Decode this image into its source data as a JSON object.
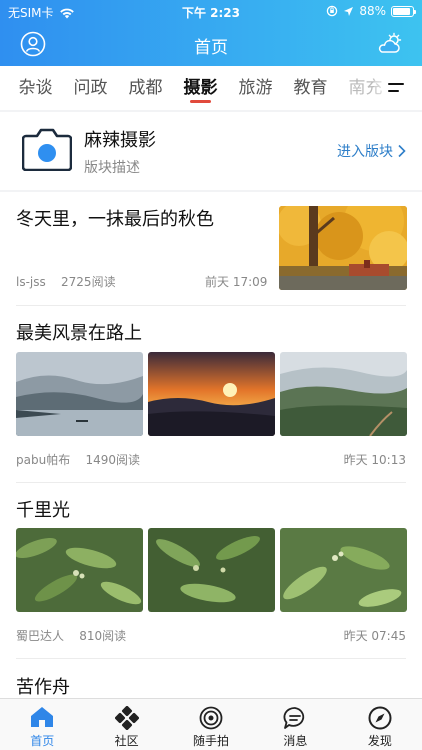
{
  "status_bar": {
    "carrier": "无SIM卡",
    "time": "下午 2:23",
    "battery": "88%",
    "battery_level": 0.88
  },
  "header": {
    "title": "首页",
    "left_icon": "user-icon",
    "right_icon": "weather-icon"
  },
  "tabs": [
    {
      "label": "杂谈",
      "active": false
    },
    {
      "label": "问政",
      "active": false
    },
    {
      "label": "成都",
      "active": false
    },
    {
      "label": "摄影",
      "active": true
    },
    {
      "label": "旅游",
      "active": false
    },
    {
      "label": "教育",
      "active": false
    },
    {
      "label": "南充",
      "active": false
    }
  ],
  "board": {
    "name": "麻辣摄影",
    "description": "版块描述",
    "enter_label": "进入版块"
  },
  "posts": [
    {
      "title": "冬天里，一抹最后的秋色",
      "author": "ls-jss",
      "reads": "2725阅读",
      "time": "前天 17:09"
    },
    {
      "title": "最美风景在路上",
      "author": "pabu帕布",
      "reads": "1490阅读",
      "time": "昨天 10:13"
    },
    {
      "title": "千里光",
      "author": "蜀巴达人",
      "reads": "810阅读",
      "time": "昨天 07:45"
    },
    {
      "title": "苦作舟"
    }
  ],
  "tabbar": [
    {
      "label": "首页",
      "icon": "home-icon",
      "active": true
    },
    {
      "label": "社区",
      "icon": "community-icon",
      "active": false
    },
    {
      "label": "随手拍",
      "icon": "snapshot-icon",
      "active": false
    },
    {
      "label": "消息",
      "icon": "message-icon",
      "active": false
    },
    {
      "label": "发现",
      "icon": "discover-icon",
      "active": false
    }
  ],
  "colors": {
    "header_gradient_start": "#2f8ff0",
    "header_gradient_end": "#3dc3f0",
    "active_tab_underline": "#e14a3c",
    "link_blue": "#2f7fc9",
    "tabbar_active": "#2f86e8"
  }
}
